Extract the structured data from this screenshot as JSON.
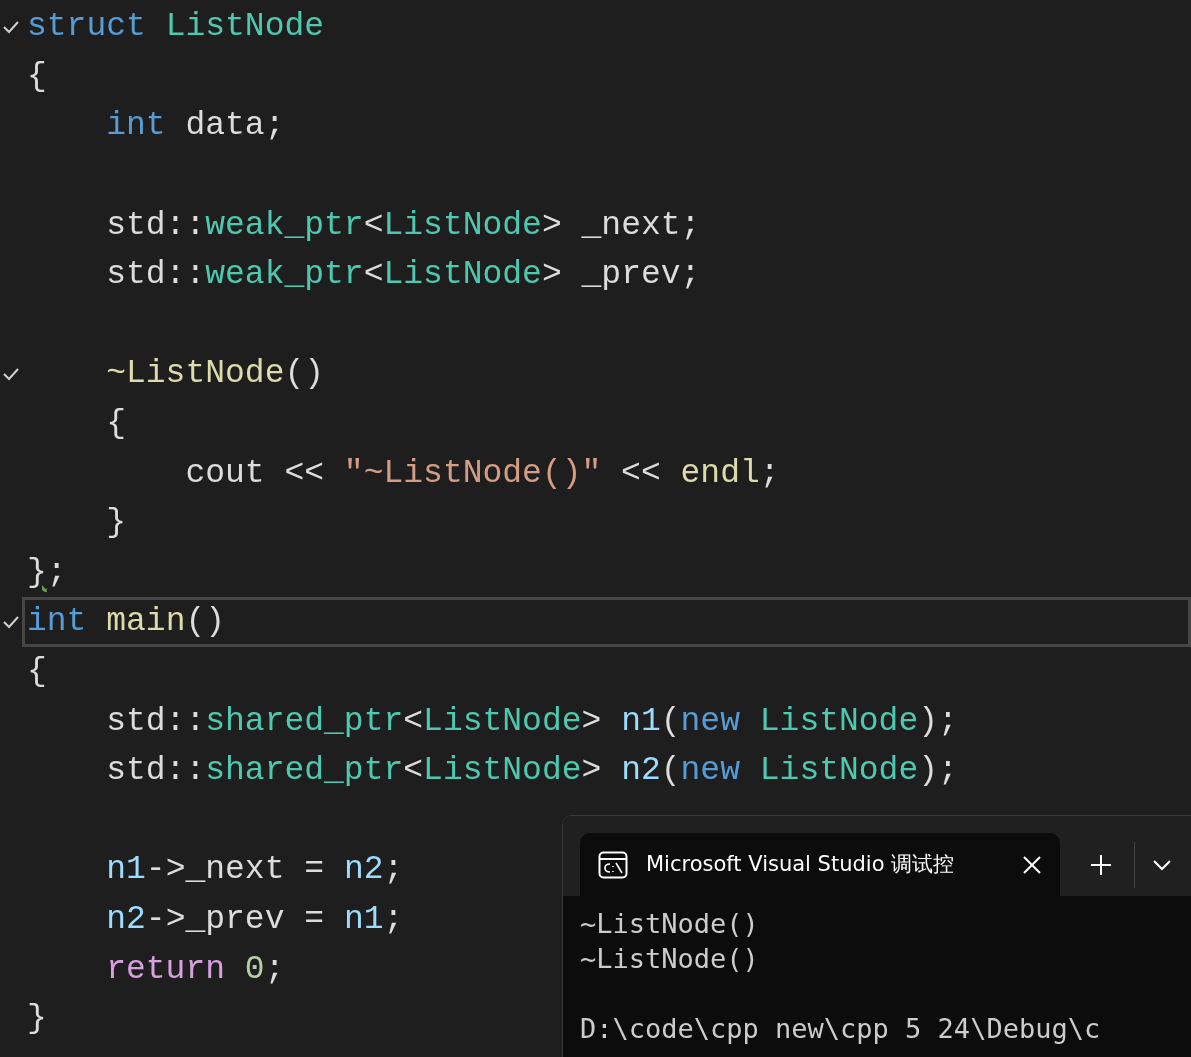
{
  "editor": {
    "lines": [
      {
        "collapsible": true,
        "selected": false,
        "tokens": [
          {
            "kind": "keyword",
            "text": "struct"
          },
          {
            "kind": "type",
            "text": " ListNode"
          }
        ]
      },
      {
        "collapsible": false,
        "selected": false,
        "tokens": [
          {
            "kind": "plain",
            "text": "{"
          }
        ]
      },
      {
        "collapsible": false,
        "selected": false,
        "tokens": [
          {
            "kind": "keyword",
            "text": "    int"
          },
          {
            "kind": "plain",
            "text": " data;"
          }
        ]
      },
      {
        "collapsible": false,
        "selected": false
      },
      {
        "collapsible": false,
        "selected": false,
        "tokens": [
          {
            "kind": "plain",
            "text": "    std::"
          },
          {
            "kind": "type",
            "text": "weak_ptr"
          },
          {
            "kind": "plain",
            "text": "<"
          },
          {
            "kind": "type",
            "text": "ListNode"
          },
          {
            "kind": "plain",
            "text": "> _next;"
          }
        ]
      },
      {
        "collapsible": false,
        "selected": false,
        "tokens": [
          {
            "kind": "plain",
            "text": "    std::"
          },
          {
            "kind": "type",
            "text": "weak_ptr"
          },
          {
            "kind": "plain",
            "text": "<"
          },
          {
            "kind": "type",
            "text": "ListNode"
          },
          {
            "kind": "plain",
            "text": "> _prev;"
          }
        ]
      },
      {
        "collapsible": false,
        "selected": false
      },
      {
        "collapsible": true,
        "selected": false,
        "tokens": [
          {
            "kind": "function",
            "text": "    ~ListNode"
          },
          {
            "kind": "plain",
            "text": "()"
          }
        ]
      },
      {
        "collapsible": false,
        "selected": false,
        "tokens": [
          {
            "kind": "plain",
            "text": "    {"
          }
        ]
      },
      {
        "collapsible": false,
        "selected": false,
        "tokens": [
          {
            "kind": "plain",
            "text": "        cout << "
          },
          {
            "kind": "string",
            "text": "\"~ListNode()\""
          },
          {
            "kind": "plain",
            "text": " << "
          },
          {
            "kind": "function",
            "text": "endl"
          },
          {
            "kind": "plain",
            "text": ";"
          }
        ]
      },
      {
        "collapsible": false,
        "selected": false,
        "tokens": [
          {
            "kind": "plain",
            "text": "    }"
          }
        ]
      },
      {
        "collapsible": false,
        "selected": false,
        "tokens": [
          {
            "kind": "plain",
            "text": "}",
            "warning": true
          },
          {
            "kind": "plain",
            "text": ";"
          }
        ]
      },
      {
        "collapsible": true,
        "selected": true,
        "tokens": [
          {
            "kind": "keyword",
            "text": "int"
          },
          {
            "kind": "function",
            "text": " main"
          },
          {
            "kind": "plain",
            "text": "()"
          }
        ]
      },
      {
        "collapsible": false,
        "selected": false,
        "tokens": [
          {
            "kind": "plain",
            "text": "{"
          }
        ]
      },
      {
        "collapsible": false,
        "selected": false,
        "tokens": [
          {
            "kind": "plain",
            "text": "    std::"
          },
          {
            "kind": "type",
            "text": "shared_ptr"
          },
          {
            "kind": "plain",
            "text": "<"
          },
          {
            "kind": "type",
            "text": "ListNode"
          },
          {
            "kind": "plain",
            "text": "> "
          },
          {
            "kind": "variable",
            "text": "n1"
          },
          {
            "kind": "plain",
            "text": "("
          },
          {
            "kind": "keyword",
            "text": "new"
          },
          {
            "kind": "type",
            "text": " ListNode"
          },
          {
            "kind": "plain",
            "text": ");"
          }
        ]
      },
      {
        "collapsible": false,
        "selected": false,
        "tokens": [
          {
            "kind": "plain",
            "text": "    std::"
          },
          {
            "kind": "type",
            "text": "shared_ptr"
          },
          {
            "kind": "plain",
            "text": "<"
          },
          {
            "kind": "type",
            "text": "ListNode"
          },
          {
            "kind": "plain",
            "text": "> "
          },
          {
            "kind": "variable",
            "text": "n2"
          },
          {
            "kind": "plain",
            "text": "("
          },
          {
            "kind": "keyword",
            "text": "new"
          },
          {
            "kind": "type",
            "text": " ListNode"
          },
          {
            "kind": "plain",
            "text": ");"
          }
        ]
      },
      {
        "collapsible": false,
        "selected": false
      },
      {
        "collapsible": false,
        "selected": false,
        "tokens": [
          {
            "kind": "variable",
            "text": "    n1"
          },
          {
            "kind": "plain",
            "text": "->_next = "
          },
          {
            "kind": "variable",
            "text": "n2"
          },
          {
            "kind": "plain",
            "text": ";"
          }
        ]
      },
      {
        "collapsible": false,
        "selected": false,
        "tokens": [
          {
            "kind": "variable",
            "text": "    n2"
          },
          {
            "kind": "plain",
            "text": "->_prev = "
          },
          {
            "kind": "variable",
            "text": "n1"
          },
          {
            "kind": "plain",
            "text": ";"
          }
        ]
      },
      {
        "collapsible": false,
        "selected": false,
        "tokens": [
          {
            "kind": "control",
            "text": "    return"
          },
          {
            "kind": "number",
            "text": " 0"
          },
          {
            "kind": "plain",
            "text": ";"
          }
        ]
      },
      {
        "collapsible": false,
        "selected": false,
        "tokens": [
          {
            "kind": "plain",
            "text": "}"
          }
        ]
      }
    ]
  },
  "terminal": {
    "tab_title": "Microsoft Visual Studio 调试控",
    "output": [
      "~ListNode()",
      "~ListNode()"
    ],
    "prompt": "D:\\code\\cpp new\\cpp 5 24\\Debug\\c"
  }
}
